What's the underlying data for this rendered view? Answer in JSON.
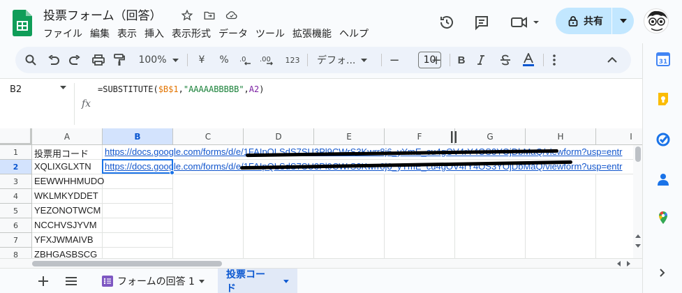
{
  "doc": {
    "title": "投票フォーム（回答）"
  },
  "menu": [
    "ファイル",
    "編集",
    "表示",
    "挿入",
    "表示形式",
    "データ",
    "ツール",
    "拡張機能",
    "ヘルプ"
  ],
  "share": {
    "label": "共有"
  },
  "toolbar": {
    "zoom": "100%",
    "currency": "¥",
    "percent": "%",
    "number_format": "123",
    "font": "デフォ...",
    "font_size": "10",
    "minus": "−",
    "plus": "+",
    "bold": "B"
  },
  "formula_bar": {
    "cell_ref": "B2",
    "fx": "fx",
    "formula_prefix": "=SUBSTITUTE(",
    "formula_ref1": "$B$1",
    "formula_comma1": ",",
    "formula_string": "\"AAAAABBBBB\"",
    "formula_comma2": ",",
    "formula_ref2": "A2",
    "formula_suffix": ")"
  },
  "grid": {
    "columns": [
      "A",
      "B",
      "C",
      "D",
      "E",
      "F",
      "G",
      "H",
      "I"
    ],
    "rows": [
      "1",
      "2",
      "3",
      "4",
      "5",
      "6",
      "7",
      "8"
    ],
    "col_a": [
      "投票用コード",
      "XQLIXGLXTN",
      "EEWWHHMUDO",
      "WKLMKYDDET",
      "YEZONOTWCM",
      "NCCHVSJYVM",
      "YFXJWMAIVB",
      "ZBHGASBSCG"
    ],
    "b1": "https://docs.google.com/forms/d/e/1FAIpQLSdS7SU3Pl9CWrS3Kwrr8j6_yYmE_cu4gOV4rY4OS3YOjDbMaQ/viewform?usp=entr",
    "b2": "https://docs.google.com/forms/d/e/1FAIpQLSdS7SU3Pl9CWrS3Kwrr8j6_yYmE_cu4gOV4rY4OS3YOjDbMaQ/viewform?usp=entr"
  },
  "sheets": [
    {
      "label": "フォームの回答 1"
    },
    {
      "label": "投票コード"
    }
  ]
}
